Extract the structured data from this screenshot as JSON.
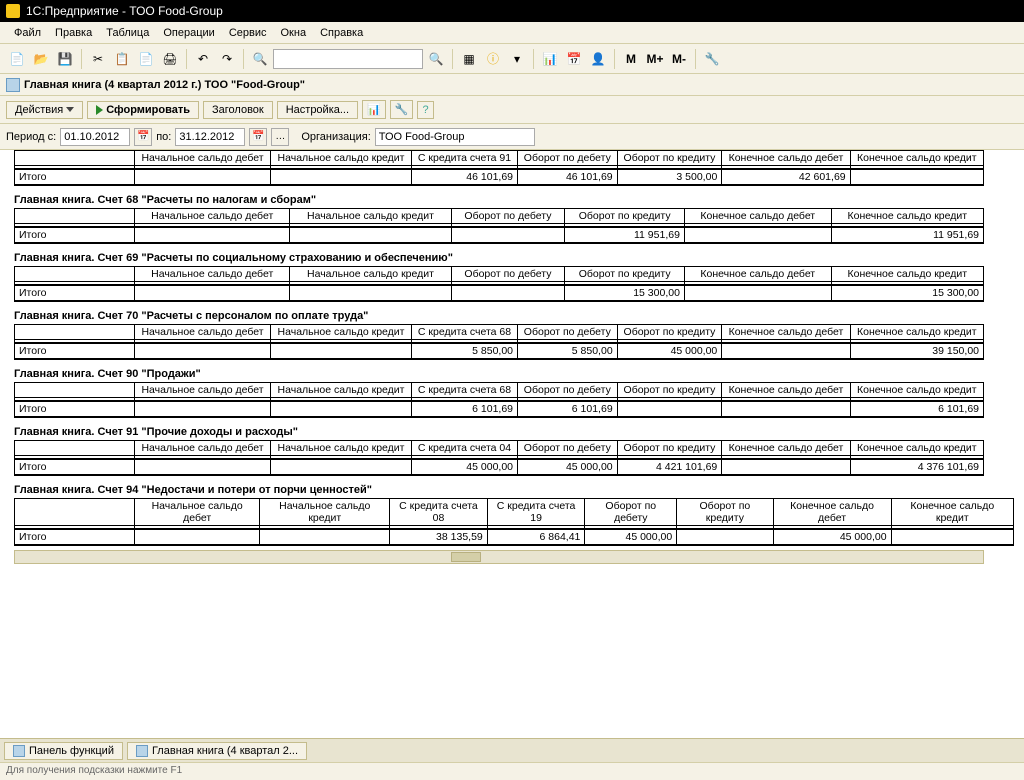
{
  "app": {
    "title": "1С:Предприятие - ТОО Food-Group"
  },
  "menu": {
    "file": "Файл",
    "edit": "Правка",
    "table": "Таблица",
    "ops": "Операции",
    "service": "Сервис",
    "windows": "Окна",
    "help": "Справка"
  },
  "document": {
    "title": "Главная книга (4 квартал 2012 г.) ТОО \"Food-Group\""
  },
  "actions": {
    "actions": "Действия",
    "form": "Сформировать",
    "header": "Заголовок",
    "settings": "Настройка..."
  },
  "period": {
    "label_from": "Период с:",
    "from": "01.10.2012",
    "label_to": "по:",
    "to": "31.12.2012",
    "org_label": "Организация:",
    "org": "ТОО Food-Group"
  },
  "headers": {
    "beg_debit": "Начальное сальдо дебет",
    "beg_credit": "Начальное сальдо кредит",
    "turn_debit": "Оборот по дебету",
    "turn_credit": "Оборот по кредиту",
    "end_debit": "Конечное сальдо дебет",
    "end_credit": "Конечное сальдо кредит",
    "credit91": "С кредита счета 91",
    "credit68": "С кредита счета 68",
    "credit04": "С кредита счета 04",
    "credit08": "С кредита счета 08",
    "credit19": "С кредита счета 19",
    "total": "Итого"
  },
  "sections": {
    "s67": {
      "row": {
        "c91": "46 101,69",
        "debit": "46 101,69",
        "credit": "3 500,00",
        "end_debit": "42 601,69"
      }
    },
    "s68": {
      "title": "Главная книга. Счет 68 \"Расчеты по налогам и сборам\"",
      "row": {
        "credit": "11 951,69",
        "end_credit": "11 951,69"
      }
    },
    "s69": {
      "title": "Главная книга. Счет 69 \"Расчеты по социальному страхованию и обеспечению\"",
      "row": {
        "credit": "15 300,00",
        "end_credit": "15 300,00"
      }
    },
    "s70": {
      "title": "Главная книга. Счет 70 \"Расчеты с персоналом по оплате труда\"",
      "row": {
        "c68": "5 850,00",
        "debit": "5 850,00",
        "credit": "45 000,00",
        "end_credit": "39 150,00"
      }
    },
    "s90": {
      "title": "Главная книга. Счет 90 \"Продажи\"",
      "row": {
        "c68": "6 101,69",
        "debit": "6 101,69",
        "credit": "",
        "end_credit": "6 101,69"
      }
    },
    "s91": {
      "title": "Главная книга. Счет 91 \"Прочие доходы и расходы\"",
      "row": {
        "c04": "45 000,00",
        "debit": "45 000,00",
        "credit": "4 421 101,69",
        "end_credit": "4 376 101,69"
      }
    },
    "s94": {
      "title": "Главная книга. Счет 94 \"Недостачи и потери от порчи ценностей\"",
      "row": {
        "c08": "38 135,59",
        "c19": "6 864,41",
        "debit": "45 000,00",
        "end_debit": "45 000,00"
      }
    }
  },
  "tabs": {
    "panel": "Панель функций",
    "ledger": "Главная книга (4 квартал 2..."
  },
  "status": "Для получения подсказки нажмите F1"
}
